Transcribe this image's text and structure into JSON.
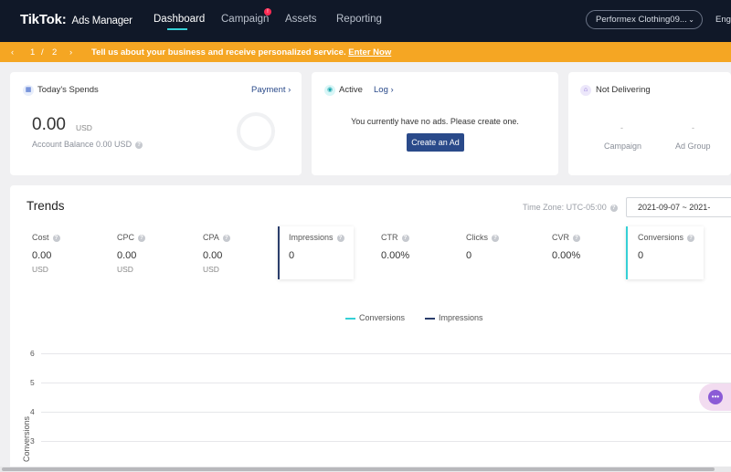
{
  "nav": {
    "logo": "TikTok",
    "logo_sub": "Ads Manager",
    "items": [
      {
        "label": "Dashboard"
      },
      {
        "label": "Campaign"
      },
      {
        "label": "Assets"
      },
      {
        "label": "Reporting"
      }
    ],
    "campaign_badge": "!",
    "account": "Performex Clothing09...",
    "language": "Eng"
  },
  "banner": {
    "prev": "‹",
    "page_current": "1",
    "page_sep": "/",
    "page_total": "2",
    "next": "›",
    "message": "Tell us about your business and receive personalized service.",
    "link": "Enter Now"
  },
  "spends": {
    "title": "Today's Spends",
    "payment_link": "Payment",
    "amount": "0.00",
    "currency": "USD",
    "balance": "Account Balance 0.00 USD"
  },
  "active": {
    "title": "Active",
    "log_link": "Log",
    "empty_message": "You currently have no ads. Please create one.",
    "create_button": "Create an Ad"
  },
  "not_delivering": {
    "title": "Not Delivering",
    "campaign_value": "-",
    "campaign_label": "Campaign",
    "adgroup_value": "-",
    "adgroup_label": "Ad Group"
  },
  "trends": {
    "title": "Trends",
    "timezone": "Time Zone: UTC-05:00",
    "date_range": "2021-09-07 ~ 2021-",
    "metrics": [
      {
        "label": "Cost",
        "value": "0.00",
        "unit": "USD"
      },
      {
        "label": "CPC",
        "value": "0.00",
        "unit": "USD"
      },
      {
        "label": "CPA",
        "value": "0.00",
        "unit": "USD"
      },
      {
        "label": "Impressions",
        "value": "0",
        "unit": ""
      },
      {
        "label": "CTR",
        "value": "0.00%",
        "unit": ""
      },
      {
        "label": "Clicks",
        "value": "0",
        "unit": ""
      },
      {
        "label": "CVR",
        "value": "0.00%",
        "unit": ""
      },
      {
        "label": "Conversions",
        "value": "0",
        "unit": ""
      }
    ],
    "legend": [
      {
        "name": "Conversions",
        "color": "#35d0d6"
      },
      {
        "name": "Impressions",
        "color": "#2a3d6b"
      }
    ],
    "y_axis_label": "Conversions",
    "y_ticks": [
      "6",
      "5",
      "4",
      "3"
    ]
  },
  "colors": {
    "nav_bg": "#101828",
    "banner_bg": "#f5a623",
    "accent_cyan": "#35d0d6",
    "primary_button": "#2a4a8a"
  },
  "icons": {
    "spends": "calendar-icon",
    "active": "active-status-icon",
    "not_delivering": "home-warning-icon",
    "chat": "chat-bubble-icon"
  }
}
